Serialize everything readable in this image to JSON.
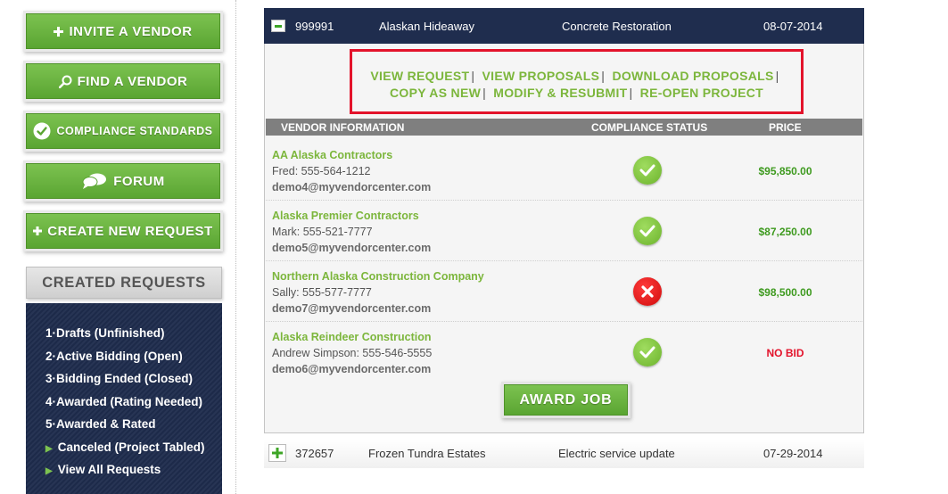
{
  "sidebar": {
    "buttons": [
      {
        "label": "INVITE A VENDOR",
        "icon": "plus-icon"
      },
      {
        "label": "FIND A VENDOR",
        "icon": "search-icon"
      },
      {
        "label": "COMPLIANCE STANDARDS",
        "icon": "check-circle-icon"
      },
      {
        "label": "FORUM",
        "icon": "speech-bubbles-icon"
      },
      {
        "label": "CREATE NEW REQUEST",
        "icon": "plus-icon"
      }
    ],
    "created_requests": {
      "title": "CREATED REQUESTS",
      "items": [
        {
          "prefix": "1·",
          "label": "Drafts (Unfinished)"
        },
        {
          "prefix": "2·",
          "label": "Active Bidding (Open)"
        },
        {
          "prefix": "3·",
          "label": "Bidding Ended (Closed)"
        },
        {
          "prefix": "4·",
          "label": "Awarded (Rating Needed)"
        },
        {
          "prefix": "5·",
          "label": "Awarded & Rated"
        },
        {
          "prefix": "▶",
          "label": "Canceled (Project Tabled)"
        },
        {
          "prefix": "▶",
          "label": "View All Requests"
        }
      ]
    }
  },
  "project": {
    "id": "999991",
    "name": "Alaskan Hideaway",
    "category": "Concrete Restoration",
    "date": "08-07-2014",
    "actions": {
      "row1": [
        "VIEW REQUEST",
        "VIEW PROPOSALS",
        "DOWNLOAD PROPOSALS"
      ],
      "row2": [
        "COPY AS NEW",
        "MODIFY & RESUBMIT",
        "RE-OPEN PROJECT"
      ],
      "separator": "|"
    },
    "table": {
      "headers": {
        "vendor": "VENDOR INFORMATION",
        "compliance": "COMPLIANCE STATUS",
        "price": "PRICE"
      },
      "rows": [
        {
          "name": "AA Alaska Contractors",
          "contact": "Fred: 555-564-1212",
          "email": "demo4@myvendorcenter.com",
          "compliant": true,
          "price": "$95,850.00"
        },
        {
          "name": "Alaska Premier Contractors",
          "contact": "Mark: 555-521-7777",
          "email": "demo5@myvendorcenter.com",
          "compliant": true,
          "price": "$87,250.00"
        },
        {
          "name": "Northern Alaska Construction Company",
          "contact": "Sally: 555-577-7777",
          "email": "demo7@myvendorcenter.com",
          "compliant": false,
          "price": "$98,500.00"
        },
        {
          "name": "Alaska Reindeer Construction",
          "contact": "Andrew Simpson: 555-546-5555",
          "email": "demo6@myvendorcenter.com",
          "compliant": true,
          "price": "NO BID"
        }
      ]
    },
    "award_label": "AWARD JOB"
  },
  "next_project": {
    "id": "372657",
    "name": "Frozen Tundra Estates",
    "category": "Electric service update",
    "date": "07-29-2014"
  },
  "colors": {
    "navy": "#1f2d4e",
    "green": "#7cb63c",
    "price_green": "#3e9a1f",
    "no_bid_red": "#e3132b",
    "highlight_border": "#e3132b"
  }
}
